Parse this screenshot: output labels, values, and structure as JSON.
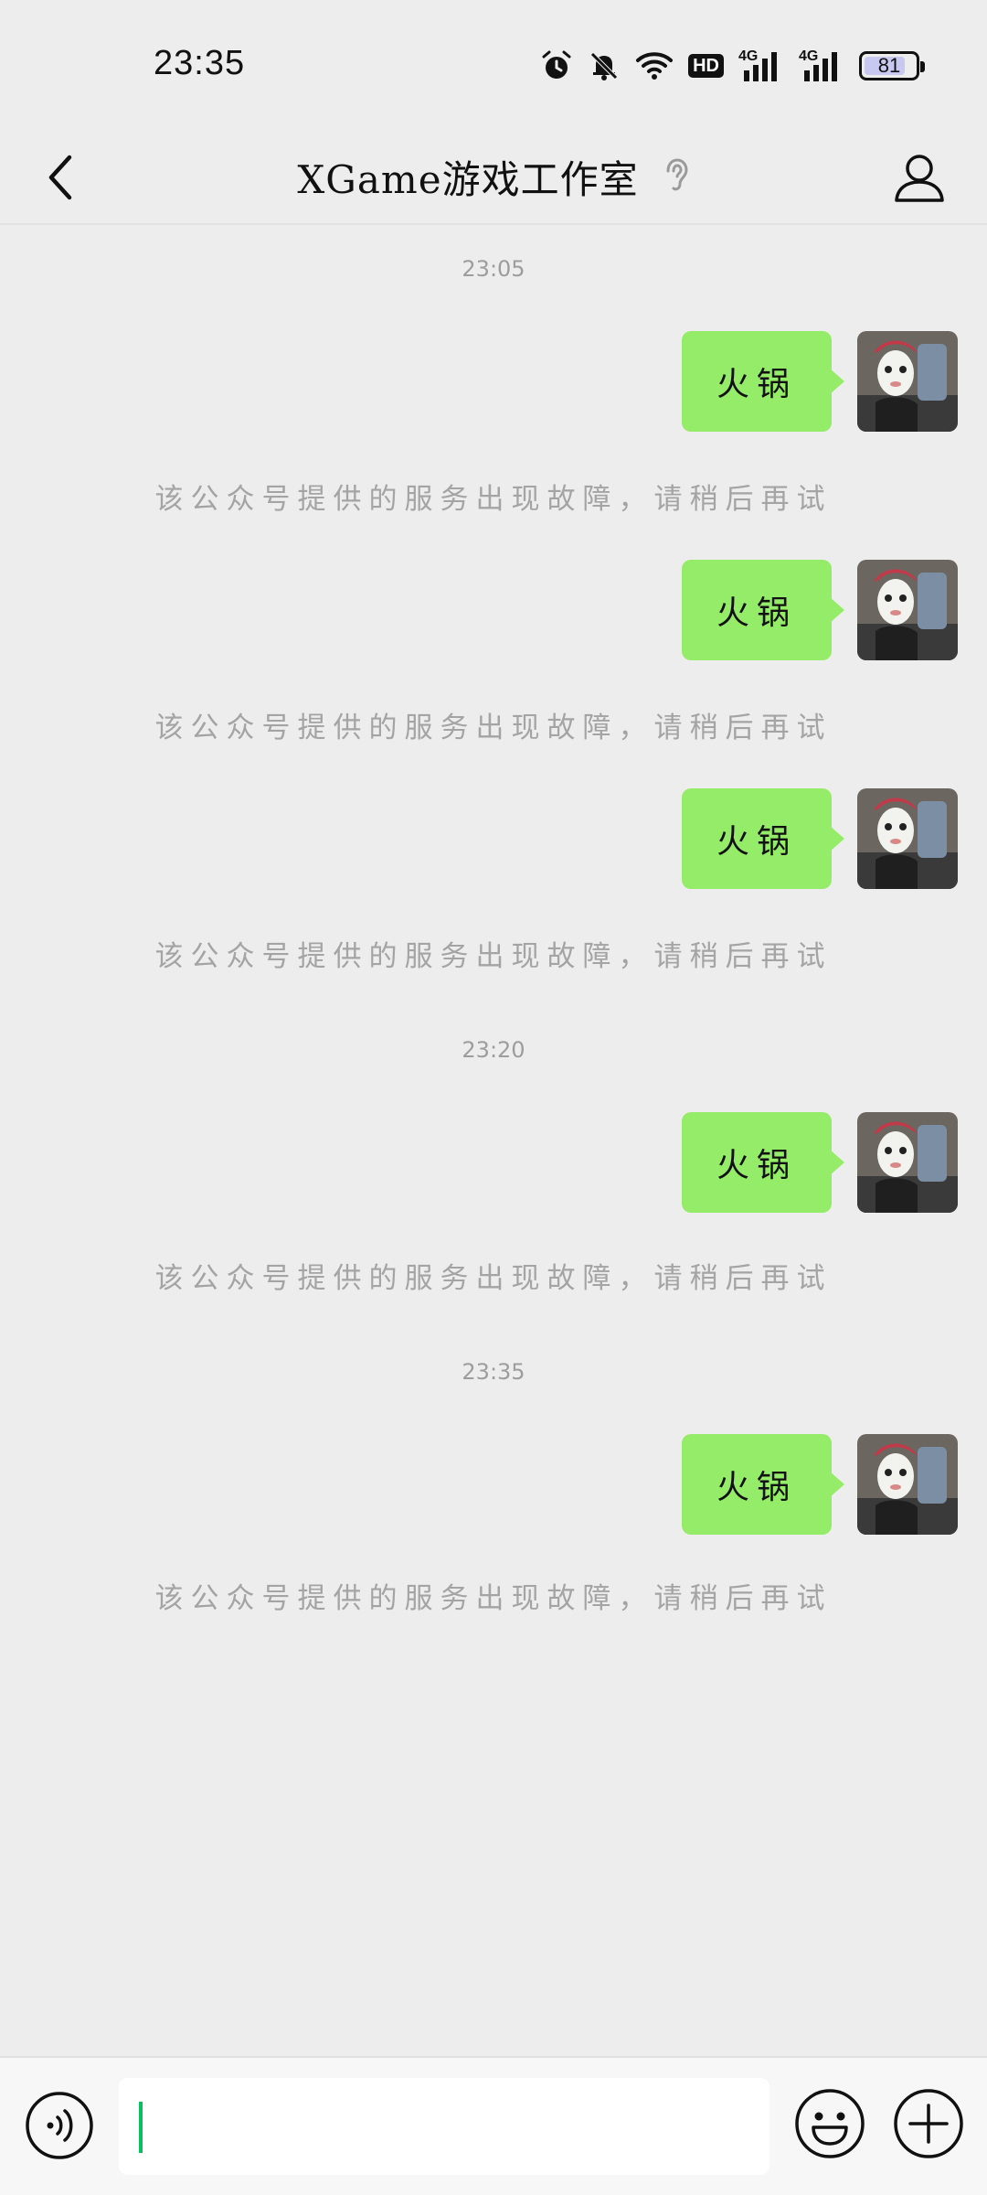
{
  "status_bar": {
    "time": "23:35",
    "hd_label": "HD",
    "network_1": "4G",
    "network_2": "4G",
    "battery_level": "81",
    "battery_fraction": 0.81,
    "icons": [
      "alarm-icon",
      "mute-bell-icon",
      "wifi-icon",
      "hd-badge",
      "signal-4g-icon",
      "signal-4g-icon",
      "battery-icon"
    ]
  },
  "nav": {
    "title": "XGame游戏工作室",
    "back_icon": "chevron-left-icon",
    "ear_icon": "ear-icon",
    "profile_icon": "person-icon"
  },
  "chat": {
    "user_message_color": "#95ec69",
    "messages": [
      {
        "timestamp": "23:05",
        "text": "火锅",
        "reply": "该公众号提供的服务出现故障，请稍后再试"
      },
      {
        "timestamp": "",
        "text": "火锅",
        "reply": "该公众号提供的服务出现故障，请稍后再试"
      },
      {
        "timestamp": "",
        "text": "火锅",
        "reply": "该公众号提供的服务出现故障，请稍后再试"
      },
      {
        "timestamp": "23:20",
        "text": "火锅",
        "reply": "该公众号提供的服务出现故障，请稍后再试"
      },
      {
        "timestamp": "23:35",
        "text": "火锅",
        "reply": "该公众号提供的服务出现故障，请稍后再试"
      }
    ]
  },
  "input_bar": {
    "text_value": "",
    "voice_icon": "voice-icon",
    "emoji_icon": "emoji-icon",
    "plus_icon": "plus-circle-icon",
    "caret_color": "#07c160"
  }
}
